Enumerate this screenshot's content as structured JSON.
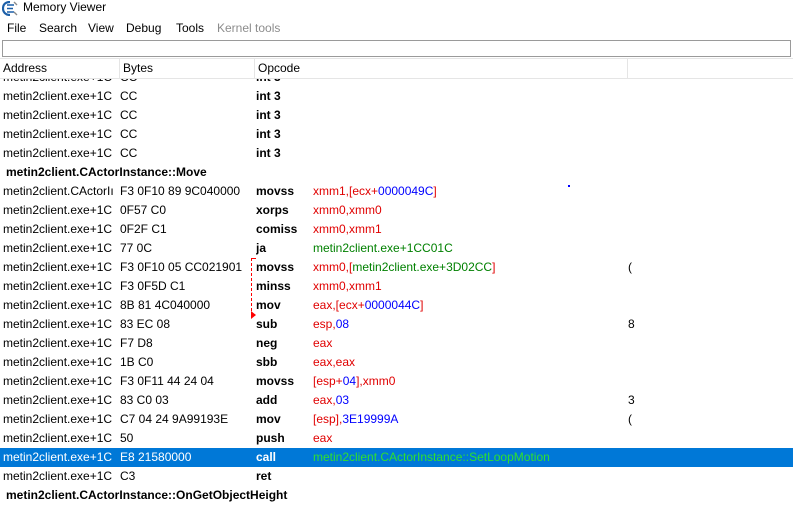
{
  "window": {
    "title": "Memory Viewer"
  },
  "menu": [
    {
      "label": "File",
      "enabled": true
    },
    {
      "label": "Search",
      "enabled": true
    },
    {
      "label": "View",
      "enabled": true
    },
    {
      "label": "Debug",
      "enabled": true
    },
    {
      "label": "Tools",
      "enabled": true
    },
    {
      "label": "Kernel tools",
      "enabled": false
    }
  ],
  "columns": {
    "address": "Address",
    "bytes": "Bytes",
    "opcode": "Opcode"
  },
  "rows": [
    {
      "addr": "metin2client.exe+1C",
      "bytes": "CC",
      "op": "int 3",
      "args": []
    },
    {
      "addr": "metin2client.exe+1C",
      "bytes": "CC",
      "op": "int 3",
      "args": []
    },
    {
      "addr": "metin2client.exe+1C",
      "bytes": "CC",
      "op": "int 3",
      "args": []
    },
    {
      "addr": "metin2client.exe+1C",
      "bytes": "CC",
      "op": "int 3",
      "args": []
    },
    {
      "addr": "metin2client.exe+1C",
      "bytes": "CC",
      "op": "int 3",
      "args": []
    },
    {
      "symbol": "metin2client.CActorInstance::Move"
    },
    {
      "addr": "metin2client.CActorIı",
      "bytes": "F3 0F10 89 9C040000",
      "op": "movss",
      "args": [
        {
          "t": "xmm1,[ecx+",
          "c": "red"
        },
        {
          "t": "0000049C",
          "c": "blue"
        },
        {
          "t": "]",
          "c": "red"
        }
      ]
    },
    {
      "addr": "metin2client.exe+1C",
      "bytes": "0F57 C0",
      "op": "xorps",
      "args": [
        {
          "t": "xmm0,xmm0",
          "c": "red"
        }
      ]
    },
    {
      "addr": "metin2client.exe+1C",
      "bytes": "0F2F C1",
      "op": "comiss",
      "args": [
        {
          "t": "xmm0,xmm1",
          "c": "red"
        }
      ]
    },
    {
      "addr": "metin2client.exe+1C",
      "bytes": "77 0C",
      "op": "ja",
      "args": [
        {
          "t": "metin2client.exe+1CC01C",
          "c": "green"
        }
      ]
    },
    {
      "addr": "metin2client.exe+1C",
      "bytes": "F3 0F10 05 CC021901",
      "op": "movss",
      "args": [
        {
          "t": "xmm0,[",
          "c": "red"
        },
        {
          "t": "metin2client.exe+3D02CC",
          "c": "green"
        },
        {
          "t": "]",
          "c": "red"
        }
      ],
      "extra": "("
    },
    {
      "addr": "metin2client.exe+1C",
      "bytes": "F3 0F5D C1",
      "op": "minss",
      "args": [
        {
          "t": "xmm0,xmm1",
          "c": "red"
        }
      ]
    },
    {
      "addr": "metin2client.exe+1C",
      "bytes": "8B 81 4C040000",
      "op": "mov",
      "args": [
        {
          "t": "eax,[ecx+",
          "c": "red"
        },
        {
          "t": "0000044C",
          "c": "blue"
        },
        {
          "t": "]",
          "c": "red"
        }
      ]
    },
    {
      "addr": "metin2client.exe+1C",
      "bytes": "83 EC 08",
      "op": "sub",
      "args": [
        {
          "t": "esp,",
          "c": "red"
        },
        {
          "t": "08",
          "c": "blue"
        }
      ],
      "extra": "8"
    },
    {
      "addr": "metin2client.exe+1C",
      "bytes": "F7 D8",
      "op": "neg",
      "args": [
        {
          "t": "eax",
          "c": "red"
        }
      ]
    },
    {
      "addr": "metin2client.exe+1C",
      "bytes": "1B C0",
      "op": "sbb",
      "args": [
        {
          "t": "eax,eax",
          "c": "red"
        }
      ]
    },
    {
      "addr": "metin2client.exe+1C",
      "bytes": "F3 0F11 44 24 04",
      "op": "movss",
      "args": [
        {
          "t": "[esp+",
          "c": "red"
        },
        {
          "t": "04",
          "c": "blue"
        },
        {
          "t": "],xmm0",
          "c": "red"
        }
      ]
    },
    {
      "addr": "metin2client.exe+1C",
      "bytes": "83 C0 03",
      "op": "add",
      "args": [
        {
          "t": "eax,",
          "c": "red"
        },
        {
          "t": "03",
          "c": "blue"
        }
      ],
      "extra": "3"
    },
    {
      "addr": "metin2client.exe+1C",
      "bytes": "C7 04 24  9A99193E",
      "op": "mov",
      "args": [
        {
          "t": "[esp],",
          "c": "red"
        },
        {
          "t": "3E19999A",
          "c": "blue"
        }
      ],
      "extra": "("
    },
    {
      "addr": "metin2client.exe+1C",
      "bytes": "50",
      "op": "push",
      "args": [
        {
          "t": "eax",
          "c": "red"
        }
      ]
    },
    {
      "addr": "metin2client.exe+1C",
      "bytes": "E8 21580000",
      "op": "call",
      "args": [
        {
          "t": "metin2client.CActorInstance::SetLoopMotion",
          "c": "green"
        }
      ],
      "selected": true
    },
    {
      "addr": "metin2client.exe+1C",
      "bytes": "C3",
      "op": "ret",
      "args": []
    },
    {
      "symbol": "metin2client.CActorInstance::OnGetObjectHeight"
    }
  ]
}
